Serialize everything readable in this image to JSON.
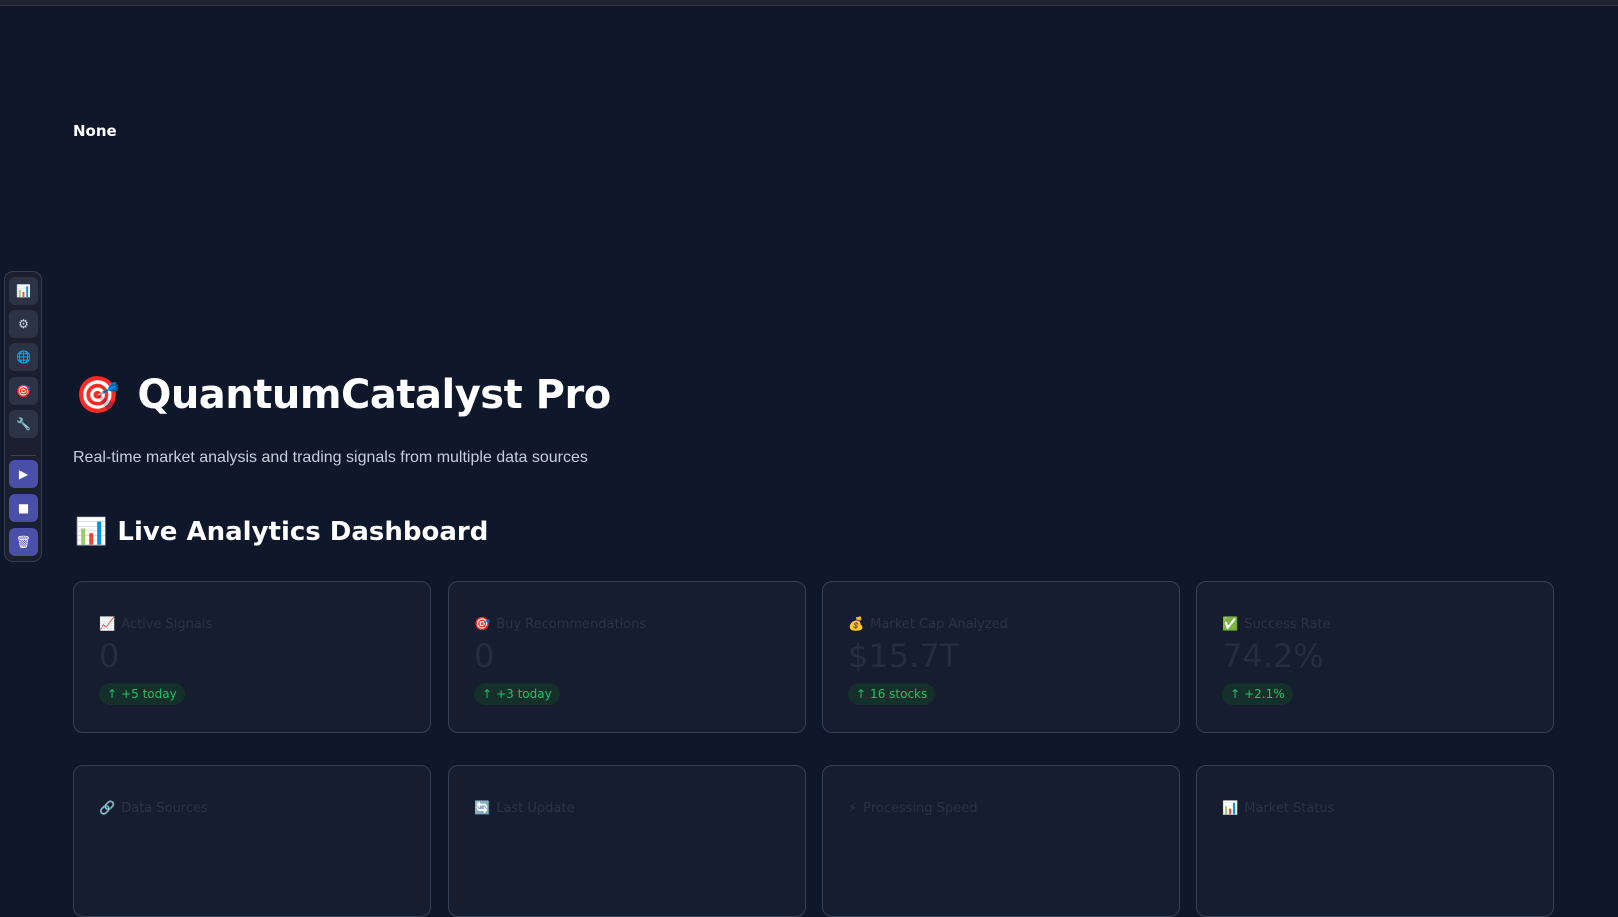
{
  "status_text": "None",
  "sidebar": {
    "buttons": [
      {
        "icon": "chart-icon",
        "glyph": "📊"
      },
      {
        "icon": "gear-icon",
        "glyph": "⚙"
      },
      {
        "icon": "globe-icon",
        "glyph": "🌐"
      },
      {
        "icon": "target-icon",
        "glyph": "🎯"
      },
      {
        "icon": "wrench-icon",
        "glyph": "🔧"
      }
    ],
    "actions": [
      {
        "icon": "play-icon",
        "glyph": "▶"
      },
      {
        "icon": "stop-icon",
        "glyph": "■"
      },
      {
        "icon": "trash-icon",
        "glyph": "🗑"
      }
    ]
  },
  "header": {
    "icon": "target-icon",
    "icon_glyph": "🎯",
    "title": "QuantumCatalyst Pro",
    "subtitle": "Real-time market analysis and trading signals from multiple data sources"
  },
  "section": {
    "icon": "bar-chart-icon",
    "icon_glyph": "📊",
    "title": "Live Analytics Dashboard"
  },
  "metrics_row1": [
    {
      "icon": "chart-up-icon",
      "glyph": "📈",
      "label": "Active Signals",
      "value": "0",
      "delta": "+5 today"
    },
    {
      "icon": "target-icon",
      "glyph": "🎯",
      "label": "Buy Recommendations",
      "value": "0",
      "delta": "+3 today"
    },
    {
      "icon": "money-bag-icon",
      "glyph": "💰",
      "label": "Market Cap Analyzed",
      "value": "$15.7T",
      "delta": "16 stocks"
    },
    {
      "icon": "check-icon",
      "glyph": "✅",
      "label": "Success Rate",
      "value": "74.2%",
      "delta": "+2.1%"
    }
  ],
  "metrics_row2": [
    {
      "icon": "link-icon",
      "glyph": "🔗",
      "label": "Data Sources"
    },
    {
      "icon": "refresh-icon",
      "glyph": "🔄",
      "label": "Last Update"
    },
    {
      "icon": "lightning-icon",
      "glyph": "⚡",
      "label": "Processing Speed"
    },
    {
      "icon": "bar-chart-icon",
      "glyph": "📊",
      "label": "Market Status"
    }
  ],
  "colors": {
    "background": "#0f172a",
    "card": "#161d2e",
    "card_border": "#344056",
    "delta_text": "#1fbf6a",
    "delta_bg": "#15302a",
    "action_button": "#4a4fa8"
  }
}
